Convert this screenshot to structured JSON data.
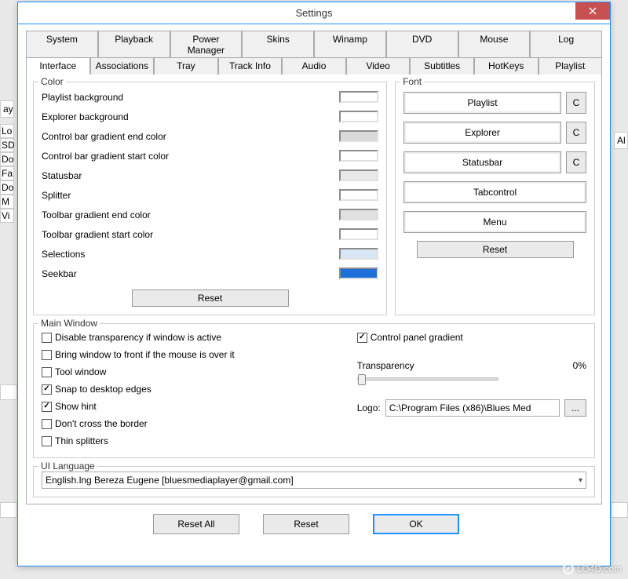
{
  "title": "Settings",
  "tabs_row1": [
    "System",
    "Playback",
    "Power Manager",
    "Skins",
    "Winamp",
    "DVD",
    "Mouse",
    "Log"
  ],
  "tabs_row2": [
    "Interface",
    "Associations",
    "Tray",
    "Track Info",
    "Audio",
    "Video",
    "Subtitles",
    "HotKeys",
    "Playlist"
  ],
  "active_tab": "Interface",
  "color_group": {
    "legend": "Color",
    "items": [
      {
        "label": "Playlist background",
        "color": "#ffffff"
      },
      {
        "label": "Explorer background",
        "color": "#ffffff"
      },
      {
        "label": "Control bar gradient end color",
        "color": "#d9d9d9"
      },
      {
        "label": "Control bar gradient start color",
        "color": "#ffffff"
      },
      {
        "label": "Statusbar",
        "color": "#e8e8e8"
      },
      {
        "label": "Splitter",
        "color": "#ffffff"
      },
      {
        "label": "Toolbar gradient end color",
        "color": "#e0e0e0"
      },
      {
        "label": "Toolbar gradient start color",
        "color": "#ffffff"
      },
      {
        "label": "Selections",
        "color": "#d8e6f5"
      },
      {
        "label": "Seekbar",
        "color": "#1e6fd9"
      }
    ],
    "reset": "Reset"
  },
  "font_group": {
    "legend": "Font",
    "buttons": [
      "Playlist",
      "Explorer",
      "Statusbar"
    ],
    "buttons_noc": [
      "Tabcontrol",
      "Menu"
    ],
    "c": "C",
    "reset": "Reset"
  },
  "mainwin": {
    "legend": "Main Window",
    "checks": [
      {
        "label": "Disable transparency if window is active",
        "checked": false
      },
      {
        "label": "Bring window to front if the mouse is over it",
        "checked": false
      },
      {
        "label": "Tool window",
        "checked": false
      },
      {
        "label": "Snap to desktop edges",
        "checked": true
      },
      {
        "label": "Show hint",
        "checked": true
      },
      {
        "label": "Don't cross the border",
        "checked": false
      },
      {
        "label": "Thin splitters",
        "checked": false
      }
    ],
    "cp_gradient": {
      "label": "Control panel gradient",
      "checked": true
    },
    "transparency_label": "Transparency",
    "transparency_value": "0%",
    "logo_label": "Logo:",
    "logo_path": "C:\\Program Files (x86)\\Blues Med",
    "browse": "..."
  },
  "ui_lang": {
    "legend": "UI Language",
    "value": "English.lng Bereza Eugene [bluesmediaplayer@gmail.com]"
  },
  "footer": {
    "reset_all": "Reset All",
    "reset": "Reset",
    "ok": "OK"
  },
  "bg_items": [
    "ay",
    "Lo",
    "SD",
    "Do",
    "Fa",
    "Do",
    "M",
    "Vi",
    "Al"
  ],
  "watermark": "LO4D.com"
}
